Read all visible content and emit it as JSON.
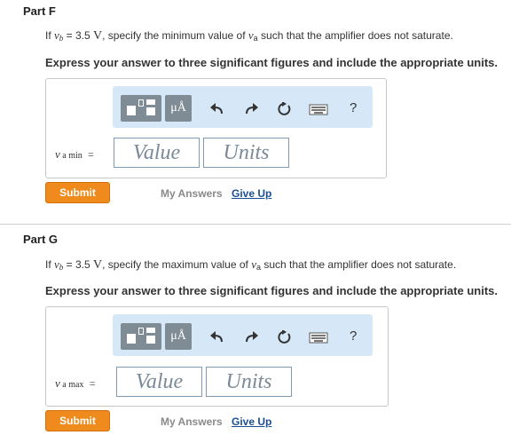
{
  "part_f": {
    "title": "Part F",
    "q_pre": "If",
    "q_var": "v",
    "q_var_sub": "b",
    "q_eq": "= 3.5",
    "q_unit": "V",
    "q_mid": ", specify the minimum value of",
    "q_var2": "v",
    "q_var2_sub": "a",
    "q_post": "such that the amplifier does not saturate.",
    "instruction": "Express your answer to three significant figures and include the appropriate units.",
    "eq_var": "v",
    "eq_sub": "a min",
    "eq_sign": "=",
    "value_placeholder": "Value",
    "units_placeholder": "Units",
    "units_button": "μÅ",
    "help": "?",
    "submit": "Submit",
    "my_answers": "My Answers",
    "give_up": "Give Up"
  },
  "part_g": {
    "title": "Part G",
    "q_pre": "If",
    "q_var": "v",
    "q_var_sub": "b",
    "q_eq": "= 3.5",
    "q_unit": "V",
    "q_mid": ", specify the maximum value of",
    "q_var2": "v",
    "q_var2_sub": "a",
    "q_post": "such that the amplifier does not saturate.",
    "instruction": "Express your answer to three significant figures and include the appropriate units.",
    "eq_var": "v",
    "eq_sub": "a max",
    "eq_sign": "=",
    "value_placeholder": "Value",
    "units_placeholder": "Units",
    "units_button": "μÅ",
    "help": "?",
    "submit": "Submit",
    "my_answers": "My Answers",
    "give_up": "Give Up"
  },
  "colors": {
    "submit_bg": "#ef8a1c",
    "toolbar_bg": "#d6e8f7",
    "link": "#1b4f92"
  }
}
